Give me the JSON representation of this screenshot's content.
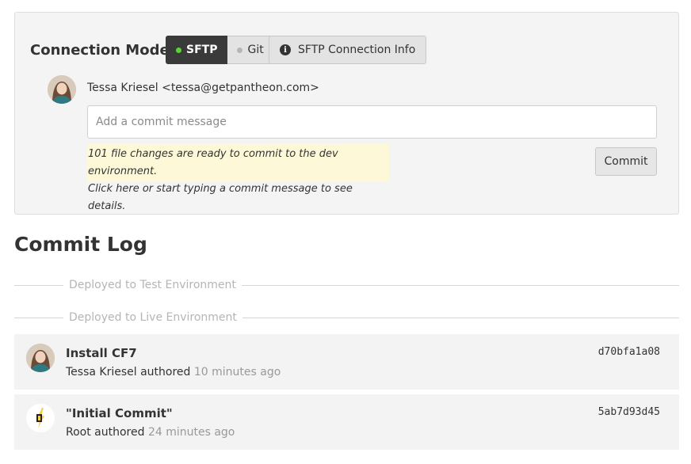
{
  "connection": {
    "label": "Connection Mode:",
    "modes": [
      {
        "label": "SFTP",
        "active": true
      },
      {
        "label": "Git",
        "active": false
      }
    ],
    "info_button": "SFTP Connection Info",
    "info_icon": "info-circle-icon"
  },
  "author": {
    "line": "Tessa Kriesel <tessa@getpantheon.com>"
  },
  "commit_form": {
    "placeholder": "Add a commit message",
    "notice_line1": "101 file changes are ready to commit to the dev environment.",
    "notice_line2": "Click here or start typing a commit message to see details.",
    "commit_button": "Commit"
  },
  "commit_log": {
    "title": "Commit Log",
    "dividers": [
      "Deployed to Test Environment",
      "Deployed to Live Environment"
    ],
    "commits": [
      {
        "title": "Install CF7",
        "author": "Tessa Kriesel authored",
        "time": "10 minutes ago",
        "hash": "d70bfa1a08"
      },
      {
        "title": "\"Initial Commit\"",
        "author": "Root authored",
        "time": "24 minutes ago",
        "hash": "5ab7d93d45"
      }
    ]
  },
  "colors": {
    "active_dot": "#5fcf3c",
    "notice_bg": "#fcf8d8",
    "panel_bg": "#f4f4f4"
  }
}
